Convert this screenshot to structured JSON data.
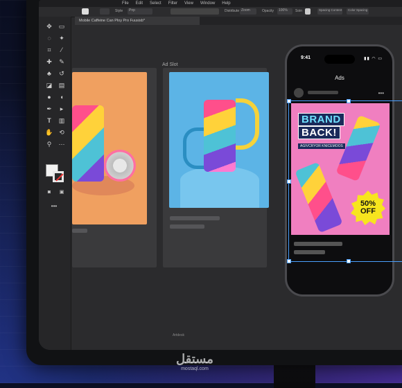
{
  "menu": [
    "File",
    "Edit",
    "Select",
    "Filter",
    "View",
    "Window",
    "Help"
  ],
  "options_bar": {
    "style": "Style",
    "width_value": "Pnp",
    "opacity_label": "Opacity",
    "zoom_value": "100%",
    "distribution": "Distribute",
    "mode": "Zoom",
    "opacity": "Opacity",
    "align_label": "Spacing Content",
    "align2_label": "Color Spacing",
    "extra": "Soin"
  },
  "document_tab": "Mobile Caffeine Can Ploy Pro Fuusisb*",
  "artboard_label": "Ad Slot",
  "bottom_label": "Artdesk",
  "phone": {
    "time": "9:41",
    "status": "▮▮ ◠ ▭",
    "app_title": "Ads",
    "more": "•••",
    "ad": {
      "headline_line1": "BRAND",
      "headline_line2": "BACK!",
      "tagline": "AGIVCRYOR KNICEMOOS",
      "badge_line1": "50%",
      "badge_line2": "OFF"
    }
  },
  "watermark": {
    "arabic": "مستقل",
    "latin": "mostaql.com"
  },
  "colors": {
    "accent_selection": "#4aa0ff",
    "ad_background": "#f07fc0",
    "badge": "#f7e51e",
    "card_orange": "#f0a060",
    "card_blue": "#5cb4e6"
  }
}
